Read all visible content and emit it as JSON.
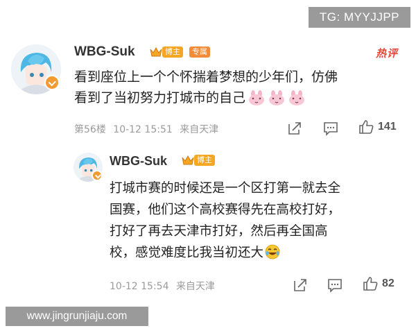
{
  "watermarks": {
    "top": "TG: MYYJJPP",
    "bottom": "www.jingrunjiaju.com"
  },
  "main_comment": {
    "username": "WBG-Suk",
    "badge_boss": "博主",
    "badge_column": "专属",
    "hot_label": "热评",
    "text_line1": "看到座位上一个个怀揣着梦想的少年们，仿佛",
    "text_line2": "看到了当初努力打城市的自己",
    "floor": "第56楼",
    "date": "10-12 15:51",
    "location": "来自天津",
    "like_count": "141",
    "icons": [
      "share-icon",
      "comment-icon",
      "like-icon"
    ]
  },
  "reply": {
    "username": "WBG-Suk",
    "badge_boss": "博主",
    "text_line1": "打城市赛的时候还是一个区打第一就去全",
    "text_line2": "国赛，他们这个高校赛得先在高校打好，",
    "text_line3": "打好了再去天津市打好，然后再全国高",
    "text_line4": "校，感觉难度比我当初还大",
    "date": "10-12 15:54",
    "location": "来自天津",
    "like_count": "82",
    "icons": [
      "share-icon",
      "comment-icon",
      "like-icon"
    ]
  },
  "colors": {
    "watermark_bg": "#9a9a9a",
    "badge_orange": "#f5a623",
    "hot_red": "#e8463a",
    "meta_gray": "#9a9a9a"
  }
}
